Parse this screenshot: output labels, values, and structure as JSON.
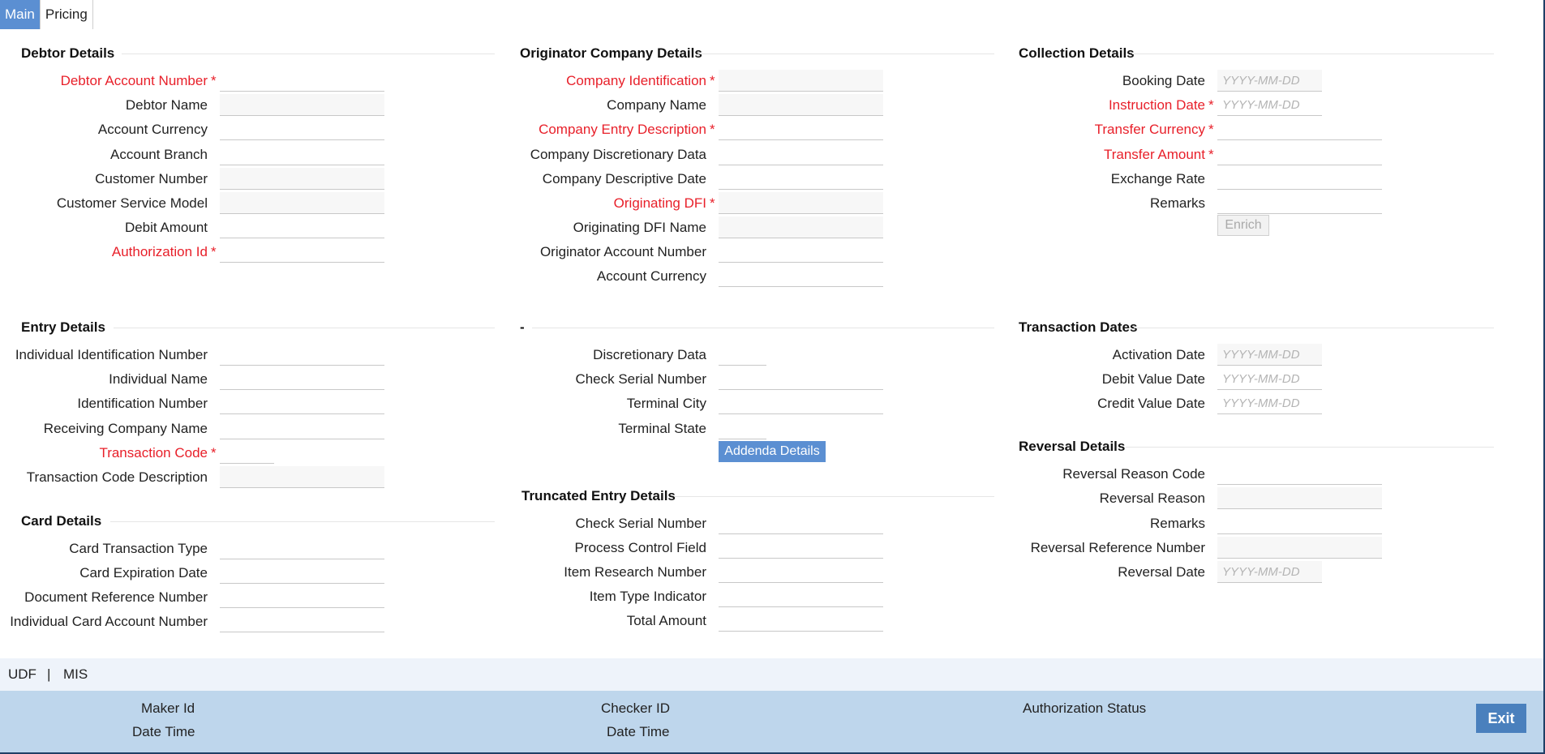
{
  "tabs": [
    {
      "label": "Main"
    },
    {
      "label": "Pricing"
    }
  ],
  "sections": {
    "debtor": {
      "title": "Debtor Details",
      "fields": [
        {
          "label": "Debtor Account Number",
          "required": true
        },
        {
          "label": "Debtor Name"
        },
        {
          "label": "Account Currency"
        },
        {
          "label": "Account Branch"
        },
        {
          "label": "Customer Number"
        },
        {
          "label": "Customer Service Model"
        },
        {
          "label": "Debit Amount"
        },
        {
          "label": "Authorization Id",
          "required": true
        }
      ]
    },
    "originator": {
      "title": "Originator Company Details",
      "fields": [
        {
          "label": "Company Identification",
          "required": true
        },
        {
          "label": "Company Name"
        },
        {
          "label": "Company Entry Description",
          "required": true
        },
        {
          "label": "Company Discretionary Data"
        },
        {
          "label": "Company Descriptive Date"
        },
        {
          "label": "Originating DFI",
          "required": true
        },
        {
          "label": "Originating DFI Name"
        },
        {
          "label": "Originator Account Number"
        },
        {
          "label": "Account Currency"
        }
      ]
    },
    "collection": {
      "title": "Collection Details",
      "fields": [
        {
          "label": "Booking Date",
          "placeholder": "YYYY-MM-DD"
        },
        {
          "label": "Instruction Date",
          "required": true,
          "placeholder": "YYYY-MM-DD"
        },
        {
          "label": "Transfer Currency",
          "required": true
        },
        {
          "label": "Transfer Amount",
          "required": true
        },
        {
          "label": "Exchange Rate"
        },
        {
          "label": "Remarks"
        }
      ],
      "enrich_label": "Enrich"
    },
    "entry": {
      "title": "Entry Details",
      "fields": [
        {
          "label": "Individual Identification Number"
        },
        {
          "label": "Individual Name"
        },
        {
          "label": "Identification Number"
        },
        {
          "label": "Receiving Company Name"
        },
        {
          "label": "Transaction Code",
          "required": true
        },
        {
          "label": "Transaction Code Description"
        }
      ]
    },
    "dash": {
      "title": "-",
      "fields": [
        {
          "label": "Discretionary Data"
        },
        {
          "label": "Check Serial Number"
        },
        {
          "label": "Terminal City"
        },
        {
          "label": "Terminal State"
        }
      ],
      "addenda_label": "Addenda Details"
    },
    "transaction_dates": {
      "title": "Transaction Dates",
      "fields": [
        {
          "label": "Activation Date",
          "placeholder": "YYYY-MM-DD"
        },
        {
          "label": "Debit Value Date",
          "placeholder": "YYYY-MM-DD"
        },
        {
          "label": "Credit Value Date",
          "placeholder": "YYYY-MM-DD"
        }
      ]
    },
    "card": {
      "title": "Card Details",
      "fields": [
        {
          "label": "Card Transaction Type"
        },
        {
          "label": "Card Expiration Date"
        },
        {
          "label": "Document Reference Number"
        },
        {
          "label": "Individual Card Account Number"
        }
      ]
    },
    "truncated": {
      "title": "Truncated Entry Details",
      "fields": [
        {
          "label": "Check Serial Number"
        },
        {
          "label": "Process Control Field"
        },
        {
          "label": "Item Research Number"
        },
        {
          "label": "Item Type Indicator"
        },
        {
          "label": "Total Amount"
        }
      ]
    },
    "reversal": {
      "title": "Reversal Details",
      "fields": [
        {
          "label": "Reversal Reason Code"
        },
        {
          "label": "Reversal Reason"
        },
        {
          "label": "Remarks"
        },
        {
          "label": "Reversal Reference Number"
        },
        {
          "label": "Reversal Date",
          "placeholder": "YYYY-MM-DD"
        }
      ]
    }
  },
  "links": {
    "udf": "UDF",
    "separator": "|",
    "mis": "MIS"
  },
  "footer": {
    "maker_id": "Maker Id",
    "maker_date_time": "Date Time",
    "checker_id": "Checker ID",
    "checker_date_time": "Date Time",
    "authorization_status": "Authorization Status",
    "exit_label": "Exit"
  }
}
